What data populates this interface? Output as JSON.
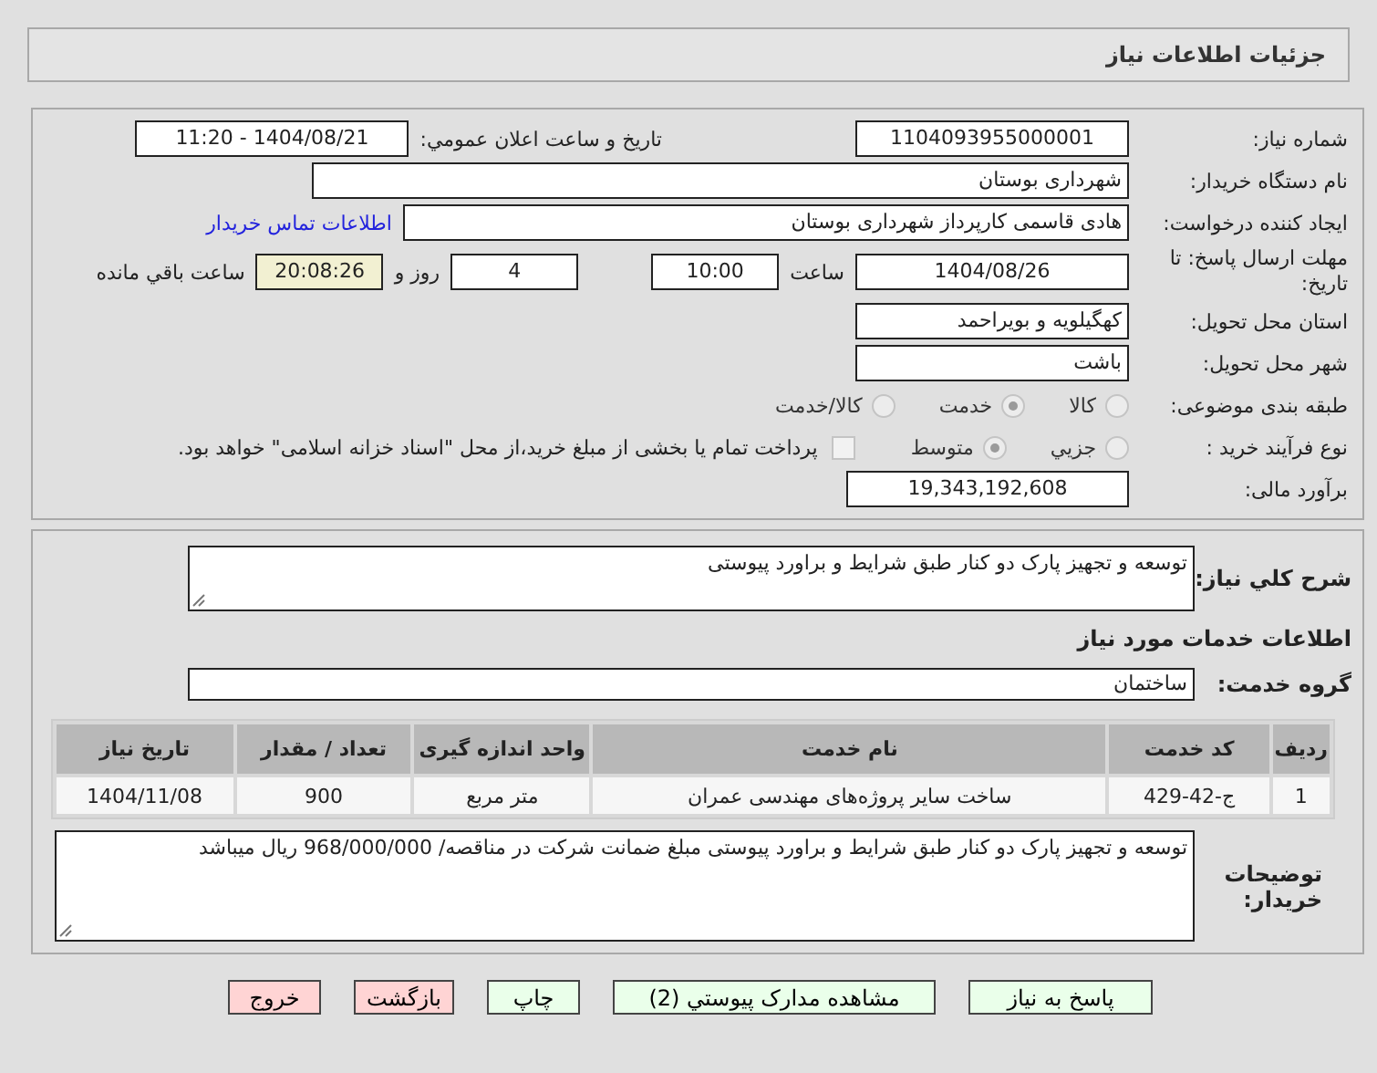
{
  "header": {
    "title": "جزئیات اطلاعات نیاز"
  },
  "need_number": {
    "label": "شماره نیاز:",
    "value": "1104093955000001"
  },
  "announce_datetime": {
    "label": "تاریخ و ساعت اعلان عمومي:",
    "value": "1404/08/21 - 11:20"
  },
  "buyer_org": {
    "label": "نام دستگاه خریدار:",
    "value": "شهرداری بوستان"
  },
  "requester": {
    "label": "ایجاد کننده درخواست:",
    "value": "هادی قاسمی کارپرداز شهرداری بوستان",
    "link": "اطلاعات تماس خریدار"
  },
  "deadline": {
    "label": "مهلت ارسال پاسخ: تا تاریخ:",
    "date": "1404/08/26",
    "time_label": "ساعت",
    "time": "10:00",
    "days": "4",
    "days_label": "روز و",
    "remaining": "20:08:26",
    "remaining_label": "ساعت باقي مانده"
  },
  "province": {
    "label": "استان محل تحویل:",
    "value": "کهگیلویه و بویراحمد"
  },
  "city": {
    "label": "شهر محل تحویل:",
    "value": "باشت"
  },
  "classification": {
    "label": "طبقه بندی موضوعی:",
    "options": [
      {
        "label": "کالا",
        "selected": false
      },
      {
        "label": "خدمت",
        "selected": true
      },
      {
        "label": "کالا/خدمت",
        "selected": false
      }
    ]
  },
  "purchase_type": {
    "label": "نوع فرآیند خرید :",
    "options": [
      {
        "label": "جزيي",
        "selected": false
      },
      {
        "label": "متوسط",
        "selected": true
      }
    ],
    "treasury": {
      "checked": false,
      "label": "پرداخت تمام یا بخشی از مبلغ خرید،از محل \"اسناد خزانه اسلامی\" خواهد بود."
    }
  },
  "estimate": {
    "label": "برآورد مالی:",
    "value": "19,343,192,608"
  },
  "description": {
    "label": "شرح کلي نیاز:",
    "value": "توسعه و تجهیز پارک دو کنار طبق شرایط و براورد پیوستی"
  },
  "services_heading": "اطلاعات خدمات مورد نیاز",
  "service_group": {
    "label": "گروه خدمت:",
    "value": "ساختمان"
  },
  "table": {
    "columns": [
      "ردیف",
      "کد خدمت",
      "نام خدمت",
      "واحد اندازه گیری",
      "تعداد / مقدار",
      "تاریخ نیاز"
    ],
    "rows": [
      [
        "1",
        "ج-42-429",
        "ساخت سایر پروژه‌های مهندسی عمران",
        "متر مربع",
        "900",
        "1404/11/08"
      ]
    ]
  },
  "buyer_notes": {
    "label": "توضیحات خریدار:",
    "value": "توسعه و تجهیز پارک دو کنار طبق شرایط و براورد پیوستی مبلغ ضمانت شرکت در مناقصه/ 968/000/000 ریال میباشد"
  },
  "buttons": [
    {
      "label": "پاسخ به نیاز",
      "kind": "action"
    },
    {
      "label": "مشاهده مدارک پیوستي (2)",
      "kind": "action"
    },
    {
      "label": "چاپ",
      "kind": "action"
    },
    {
      "label": "بازگشت",
      "kind": "exit"
    },
    {
      "label": "خروج",
      "kind": "exit"
    }
  ]
}
